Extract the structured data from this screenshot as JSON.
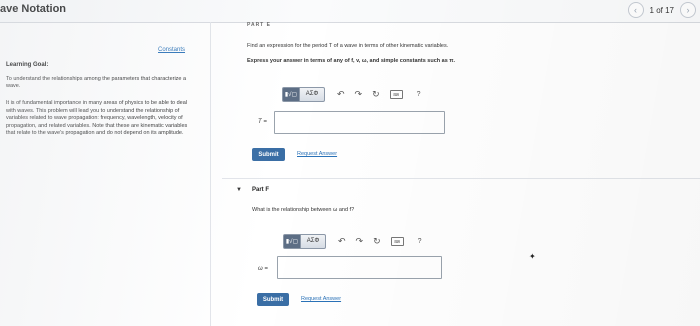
{
  "header": {
    "title": "ave Notation",
    "pager": "1 of 17",
    "prev_icon": "chevron-left-icon",
    "next_icon": "chevron-right-icon"
  },
  "left_panel": {
    "constants_link": "Constants",
    "goal_title": "Learning Goal:",
    "goal_text": "To understand the relationships among the parameters that characterize a wave.",
    "goal_body": "It is of fundamental importance in many areas of physics to be able to deal with waves. This problem will lead you to understand the relationship of variables related to wave propagation: frequency, wavelength, velocity of propagation, and related variables. Note that these are kinematic variables that relate to the wave's propagation and do not depend on its amplitude."
  },
  "part_e": {
    "header": "PART E",
    "question": "Find an expression for the period T of a wave in terms of other kinematic variables.",
    "instruction": "Express your answer in terms of any of f, v, ω, and simple constants such as π.",
    "answer_label": "T =",
    "submit": "Submit",
    "request_answer": "Request Answer"
  },
  "part_f": {
    "title": "Part F",
    "question": "What is the relationship between ω and f?",
    "answer_label": "ω =",
    "submit": "Submit",
    "request_answer": "Request Answer"
  },
  "toolbar": {
    "sqrt_label": "▮√▢",
    "greek_label": "ΑΣΦ",
    "undo_icon": "undo-icon",
    "redo_icon": "redo-icon",
    "reset_icon": "reset-icon",
    "keyboard_icon": "keyboard-icon",
    "help_label": "?"
  }
}
